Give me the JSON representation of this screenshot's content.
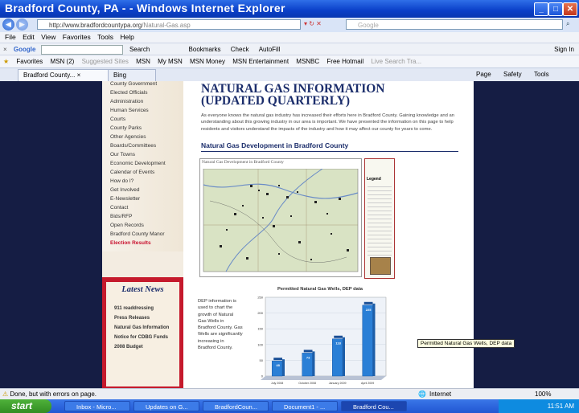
{
  "window": {
    "title": "Bradford County, PA - - Windows Internet Explorer"
  },
  "address_bar": {
    "url_host": "http://www.bradfordcountypa.org",
    "url_path": "/Natural-Gas.asp",
    "search_placeholder": "Google"
  },
  "menu": [
    "File",
    "Edit",
    "View",
    "Favorites",
    "Tools",
    "Help"
  ],
  "google_toolbar": {
    "label": "Google",
    "items": [
      "Search",
      "Bookmarks",
      "Check",
      "AutoFill"
    ],
    "signin": "Sign In"
  },
  "favorites": [
    "Favorites",
    "MSN (2)",
    "Suggested Sites",
    "MSN",
    "My MSN",
    "MSN Money",
    "MSN Entertainment",
    "MSNBC",
    "Free Hotmail",
    "Live Search Tra..."
  ],
  "tabs": {
    "active": "Bradford County...",
    "second": "Bing",
    "tools": [
      "Page",
      "Safety",
      "Tools"
    ]
  },
  "sidebar": {
    "items": [
      "County Government",
      "Elected Officials",
      "Administration",
      "Human Services",
      "Courts",
      "County Parks",
      "Other Agencies",
      "Boards/Committees",
      "Our Towns",
      "Economic Development",
      "Calendar of Events",
      "How do I?",
      "Get Involved",
      "E-Newsletter",
      "Contact",
      "Bids/RFP",
      "Open Records",
      "Bradford County Manor",
      "Election Results"
    ],
    "news_title": "Latest News",
    "news_items": [
      "911 readdressing",
      "Press Releases",
      "Natural Gas Information",
      "Notice for CDBG Funds",
      "2008 Budget"
    ]
  },
  "main": {
    "title_line1": "NATURAL GAS INFORMATION",
    "title_line2": "(UPDATED QUARTERLY)",
    "intro": "As everyone knows the natural gas industry has increased their efforts here in Bradford County. Gaining knowledge and an understanding about this growing industry in our area is important. We have presented the information on this page to help residents and visitors understand the impacts of the industry and how it may affect our county for years to come.",
    "section_title": "Natural Gas Development in Bradford County",
    "map_title": "Natural Gas Development in Bradford County",
    "legend_title": "Legend",
    "chart_text": "DEP information is used to chart the growth of Natural Gas Wells in Bradford County. Gas Wells are significantly increasing in Bradford County.",
    "tooltip": "Permitted Natural Gas Wells, DEP data"
  },
  "chart_data": {
    "type": "bar",
    "title": "Permitted Natural Gas Wells, DEP data",
    "categories": [
      "July 2008",
      "October 2008",
      "January 2009",
      "April 2009"
    ],
    "values": [
      48,
      73,
      118,
      225
    ],
    "ylim": [
      0,
      250
    ],
    "yticks": [
      0,
      50,
      100,
      150,
      200,
      250
    ],
    "color": "#2a7fd6"
  },
  "status": {
    "text": "Done, but with errors on page.",
    "zone": "Internet",
    "zoom": "100%"
  },
  "taskbar": {
    "start": "start",
    "items": [
      "Inbox - Micro...",
      "Updates on G...",
      "BradfordCoun...",
      "Document1 - ...",
      "Bradford Cou..."
    ],
    "clock": "11:51 AM"
  }
}
